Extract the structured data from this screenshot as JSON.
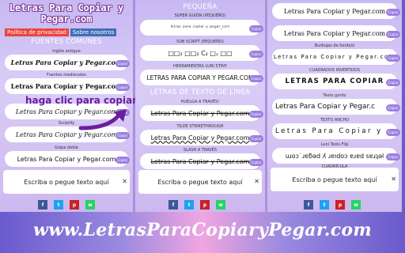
{
  "site": {
    "title_line1": "Letras Para Copiar y",
    "title_line2": "Pegar.com"
  },
  "nav": {
    "privacy": "Política de privacidad",
    "about": "Sobre nosotros"
  },
  "panel1": {
    "section": "FUENTES COMUNES",
    "items": [
      {
        "label": "Inglés antiguo",
        "text": "Letras Para Copiar y Pegar.com"
      },
      {
        "label": "Fuentes medievales",
        "text": "Letras Para Copiar y Pegar.com"
      },
      {
        "label": "",
        "text": "Letras Para Copiar y Pegar.com"
      },
      {
        "label": "Scriptify",
        "text": "Letras Para Copiar y Pegar.com"
      },
      {
        "label": "Golpe doble",
        "text": "Letras Para Copiar y Pegar.com"
      }
    ],
    "hint": "haga clic para copiar",
    "copy": "Copiar",
    "input_placeholder": "Escriba o pegue texto aquí",
    "close": "✕"
  },
  "panel2": {
    "section_top": "PEQUEÑA",
    "items_top": [
      {
        "label": "SUPER GUIÓN (PEQUEÑO)",
        "text": "ˡᵉᵗʳᵃˢ ᵖᵃʳᵃ ᶜᵒᵖⁱᵃʳ ʸ ᵖᵉᵍᵃʳ.ᶜᵒᵐ"
      },
      {
        "label": "SUB SCRIPT (PEQUEÑO)",
        "text": "□□₂ □□₂ C₂ □ᵧ □□"
      },
      {
        "label": "HERRAMIENTAS LUNI STINY",
        "text": "LETRAS PARA COPIAR Y PEGAR.COM"
      }
    ],
    "section_lines": "LETRAS DE TEXTO DE LÍNEA",
    "items_lines": [
      {
        "label": "HUELGA A TRAVÉS!",
        "text": "Letras Para Copiar y Pegar.com"
      },
      {
        "label": "TILDE STRIKETHROUGH",
        "text": "Letras Para Copiar y Pegar.com"
      },
      {
        "label": "SLASH A TRAVÉS",
        "text": "Letras Para Copiar y Pegar.com"
      }
    ],
    "copy": "Copiar",
    "input_placeholder": "Escriba o pegue texto aquí",
    "close": "✕"
  },
  "panel3": {
    "items": [
      {
        "label": "",
        "text": "Letras Para Copiar y Pegar.com"
      },
      {
        "label": "",
        "text": "Letras Para Copiar y Pegar.com"
      },
      {
        "label": "Burbujas de fondo/o",
        "text": "Letras Para Copiar y Pegar.com"
      },
      {
        "label": "CUADRADOS INVERTIDOS",
        "text": "LETRAS PARA COPIAR"
      },
      {
        "label": "Texto gordo",
        "text": "Letras Para Copiar y Pegar.c"
      },
      {
        "label": "TEXTO ANCHO",
        "text": "Letras Para Copiar y"
      },
      {
        "label": "Luni Tools Flip",
        "text": "ɯoɔ˙ɹɐƃǝd ʎ ɹɐıdoɔ ɐɹɐd sɐɹʇǝl"
      },
      {
        "label": "CUADRÍCULA",
        "text": ""
      }
    ],
    "copy": "Copiar",
    "input_placeholder": "Escriba o pegue texto aquí",
    "close": "✕"
  },
  "share": {
    "fb": "f",
    "tw": "t",
    "pin": "p",
    "wa": "w"
  },
  "url": "www.LetrasParaCopiaryPegar.com"
}
